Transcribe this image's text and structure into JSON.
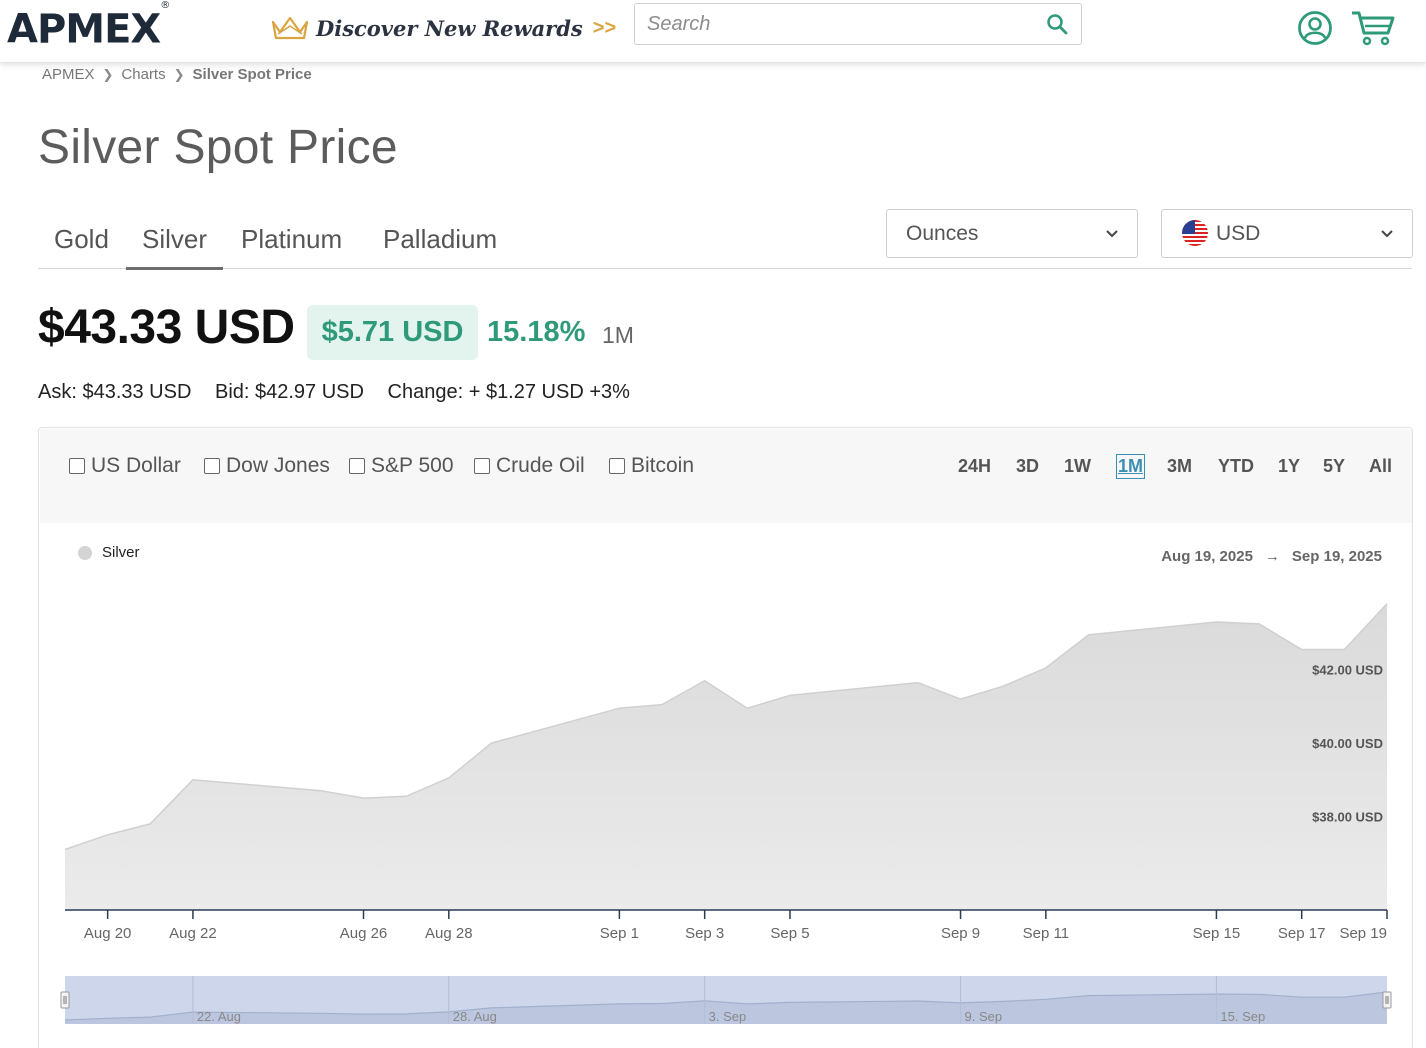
{
  "header": {
    "logo": "APMEX",
    "logo_mark": "®",
    "promo_text": "Discover New Rewards",
    "promo_arrows": ">>",
    "search_placeholder": "Search",
    "icons": [
      "crown-icon",
      "search-icon",
      "account-icon",
      "cart-icon"
    ]
  },
  "breadcrumb": [
    "APMEX",
    "Charts",
    "Silver Spot Price"
  ],
  "page_title": "Silver Spot Price",
  "metal_tabs": [
    "Gold",
    "Silver",
    "Platinum",
    "Palladium"
  ],
  "active_tab": "Silver",
  "unit_select": "Ounces",
  "currency_select": "USD",
  "price": "$43.33 USD",
  "change_amount": "$5.71 USD",
  "change_percent": "15.18%",
  "change_period": "1M",
  "ask": "Ask: $43.33 USD",
  "bid": "Bid: $42.97 USD",
  "change_line": "Change: + $1.27 USD +3%",
  "compare_options": [
    "US Dollar",
    "Dow Jones",
    "S&P 500",
    "Crude Oil",
    "Bitcoin"
  ],
  "range_buttons": [
    "24H",
    "3D",
    "1W",
    "1M",
    "3M",
    "YTD",
    "1Y",
    "5Y",
    "All"
  ],
  "active_range": "1M",
  "legend_label": "Silver",
  "date_from": "Aug 19, 2025",
  "date_arrow": "→",
  "date_to": "Sep 19, 2025",
  "colors": {
    "accent_green": "#2e9a79",
    "area_fill": "#e3e3e3",
    "navigator": "#cdd6ea",
    "active_range": "#3a8fb3"
  },
  "chart_data": {
    "type": "area",
    "series": [
      {
        "name": "Silver",
        "x": [
          "Aug 19",
          "Aug 20",
          "Aug 21",
          "Aug 22",
          "Aug 25",
          "Aug 26",
          "Aug 27",
          "Aug 28",
          "Aug 29",
          "Sep 1",
          "Sep 2",
          "Sep 3",
          "Sep 4",
          "Sep 5",
          "Sep 8",
          "Sep 9",
          "Sep 10",
          "Sep 11",
          "Sep 12",
          "Sep 15",
          "Sep 16",
          "Sep 17",
          "Sep 18",
          "Sep 19"
        ],
        "values": [
          37.1,
          37.5,
          37.8,
          39.0,
          38.7,
          38.5,
          38.55,
          39.05,
          40.0,
          40.95,
          41.05,
          41.7,
          40.95,
          41.3,
          41.65,
          41.2,
          41.55,
          42.05,
          42.95,
          43.3,
          43.25,
          42.55,
          42.55,
          43.8
        ]
      }
    ],
    "y_ticks": [
      "$38.00 USD",
      "$40.00 USD",
      "$42.00 USD"
    ],
    "y_tick_values": [
      38,
      40,
      42
    ],
    "x_ticks": [
      "Aug 20",
      "Aug 22",
      "Aug 26",
      "Aug 28",
      "Sep 1",
      "Sep 3",
      "Sep 5",
      "Sep 9",
      "Sep 11",
      "Sep 15",
      "Sep 17",
      "Sep 19"
    ],
    "navigator_ticks": [
      "22. Aug",
      "28. Aug",
      "3. Sep",
      "9. Sep",
      "15. Sep"
    ],
    "ylim": [
      35.45,
      44.5
    ],
    "grid": false,
    "legend": "top-left"
  }
}
